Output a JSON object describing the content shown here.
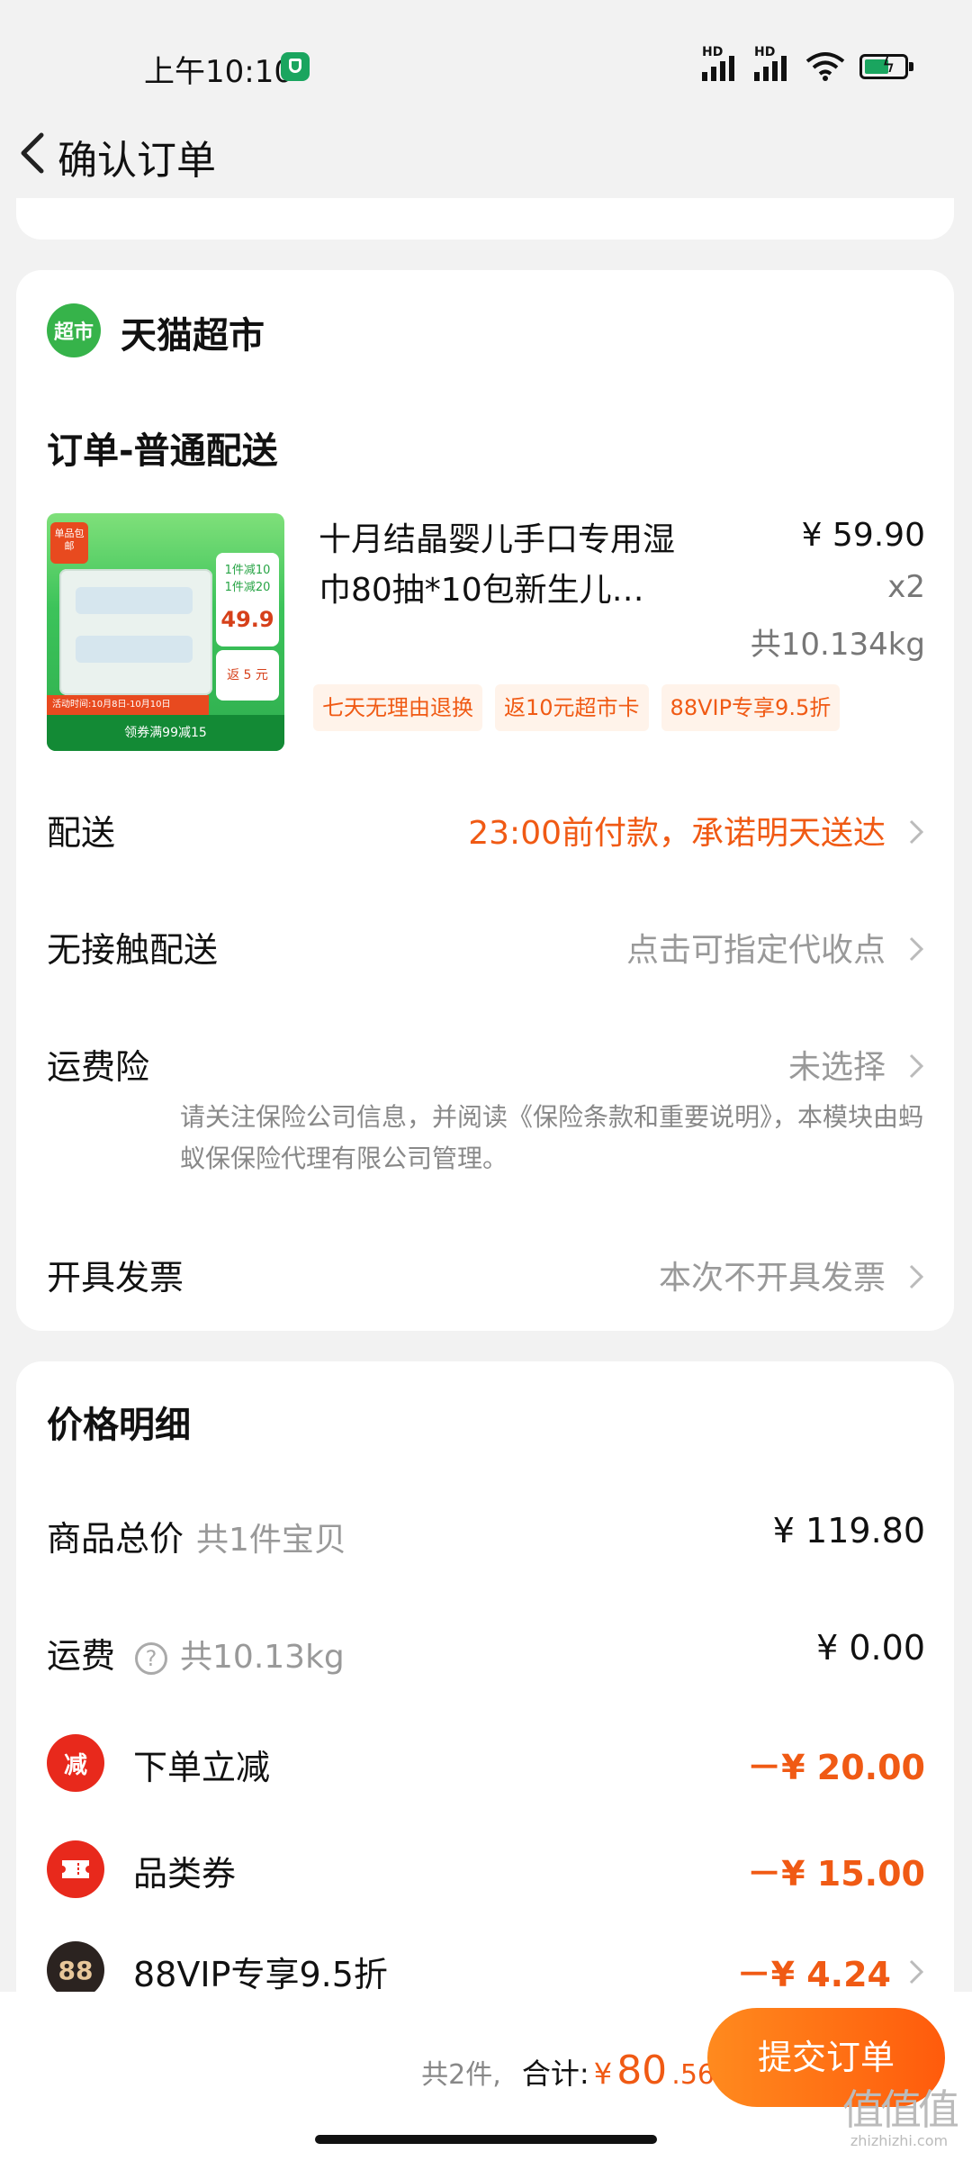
{
  "status_bar": {
    "time": "上午10:10",
    "signal_label": "HD"
  },
  "header": {
    "title": "确认订单"
  },
  "store": {
    "logo_text": "超市",
    "name": "天猫超市"
  },
  "order_section_title": "订单-普通配送",
  "product": {
    "title": "十月结晶婴儿手口专用湿巾80抽*10包新生儿…",
    "price": "¥ 59.90",
    "quantity": "x2",
    "weight": "共10.134kg",
    "tags": [
      "七天无理由退换",
      "返10元超市卡",
      "88VIP专享9.5折"
    ],
    "thumbnail": {
      "badge": "单品包邮",
      "promo_line1": "1件减10",
      "promo_line2": "1件减20",
      "price": "49.9",
      "coupon": "返 5 元",
      "date": "活动时间:10月8日-10月10日",
      "bottom": "领券满99减15"
    }
  },
  "rows": [
    {
      "label": "配送",
      "value": "23:00前付款，承诺明天送达"
    },
    {
      "label": "无接触配送",
      "value": "点击可指定代收点"
    },
    {
      "label": "运费险",
      "value": "未选择"
    },
    {
      "label": "开具发票",
      "value": "本次不开具发票"
    }
  ],
  "insurance_note": "请关注保险公司信息，并阅读《保险条款和重要说明》，本模块由蚂蚁保保险代理有限公司管理。",
  "price_detail": {
    "title": "价格明细",
    "goods_total": {
      "label": "商品总价",
      "sub": "共1件宝贝",
      "amount": "¥ 119.80"
    },
    "shipping": {
      "label": "运费",
      "sub": "共10.13kg",
      "amount": "¥ 0.00"
    },
    "discounts": [
      {
        "icon_text": "减",
        "label": "下单立减",
        "amount": "－¥ 20.00"
      },
      {
        "icon_text": "",
        "label": "品类券",
        "amount": "－¥ 15.00"
      },
      {
        "icon_text": "88",
        "label": "88VIP专享9.5折",
        "amount": "－¥ 4.24"
      }
    ]
  },
  "bottom_bar": {
    "count": "共2件,",
    "total_label": "合计:",
    "currency": "¥",
    "total_big": "80",
    "total_small": ".56",
    "submit_label": "提交订单"
  },
  "watermark": {
    "line1": "值值值",
    "line2": "zhizhizhi.com"
  },
  "colors": {
    "accent": "#f05a14",
    "store_green": "#36b34a"
  }
}
